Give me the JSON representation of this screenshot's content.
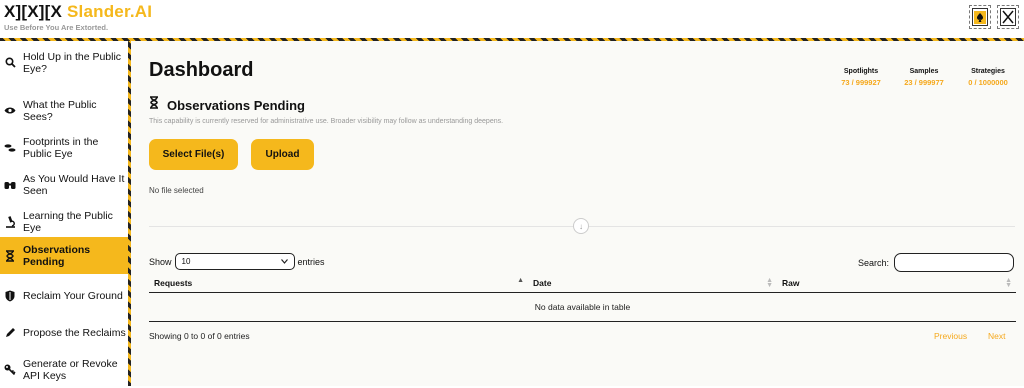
{
  "header": {
    "brand_prefix": "X][X][X",
    "brand_name": "Slander.AI",
    "tagline": "Use Before You Are Extorted.",
    "icons": [
      "spade-badge-icon",
      "close-x-icon"
    ]
  },
  "sidebar": {
    "items": [
      {
        "label": "Hold Up in the Public Eye?",
        "icon": "search-icon",
        "active": false
      },
      {
        "label": "What the Public Sees?",
        "icon": "eye-icon",
        "active": false
      },
      {
        "label": "Footprints in the Public Eye",
        "icon": "footprints-icon",
        "active": false
      },
      {
        "label": "As You Would Have It Seen",
        "icon": "binoculars-icon",
        "active": false
      },
      {
        "label": "Learning the Public Eye",
        "icon": "microscope-icon",
        "active": false
      },
      {
        "label": "Observations Pending",
        "icon": "hourglass-icon",
        "active": true
      },
      {
        "label": "Reclaim Your Ground",
        "icon": "shield-icon",
        "active": false
      },
      {
        "label": "Propose the Reclaims",
        "icon": "pencil-icon",
        "active": false
      },
      {
        "label": "Generate or Revoke API Keys",
        "icon": "key-icon",
        "active": false
      }
    ]
  },
  "main": {
    "title": "Dashboard",
    "stats": [
      {
        "label": "Spotlights",
        "value": "73 / 999927"
      },
      {
        "label": "Samples",
        "value": "23 / 999977"
      },
      {
        "label": "Strategies",
        "value": "0 / 1000000"
      }
    ],
    "section_title": "Observations Pending",
    "note": "This capability is currently reserved for administrative use. Broader visibility may follow as understanding deepens.",
    "select_files_label": "Select File(s)",
    "upload_label": "Upload",
    "file_status": "No file selected",
    "table": {
      "show_label": "Show",
      "page_length": "10",
      "entries_label": "entries",
      "search_label": "Search:",
      "search_value": "",
      "columns": [
        "Requests",
        "Date",
        "Raw"
      ],
      "empty_message": "No data available in table",
      "info": "Showing 0 to 0 of 0 entries",
      "prev_label": "Previous",
      "next_label": "Next"
    },
    "accent_color": "#f5b81c"
  }
}
